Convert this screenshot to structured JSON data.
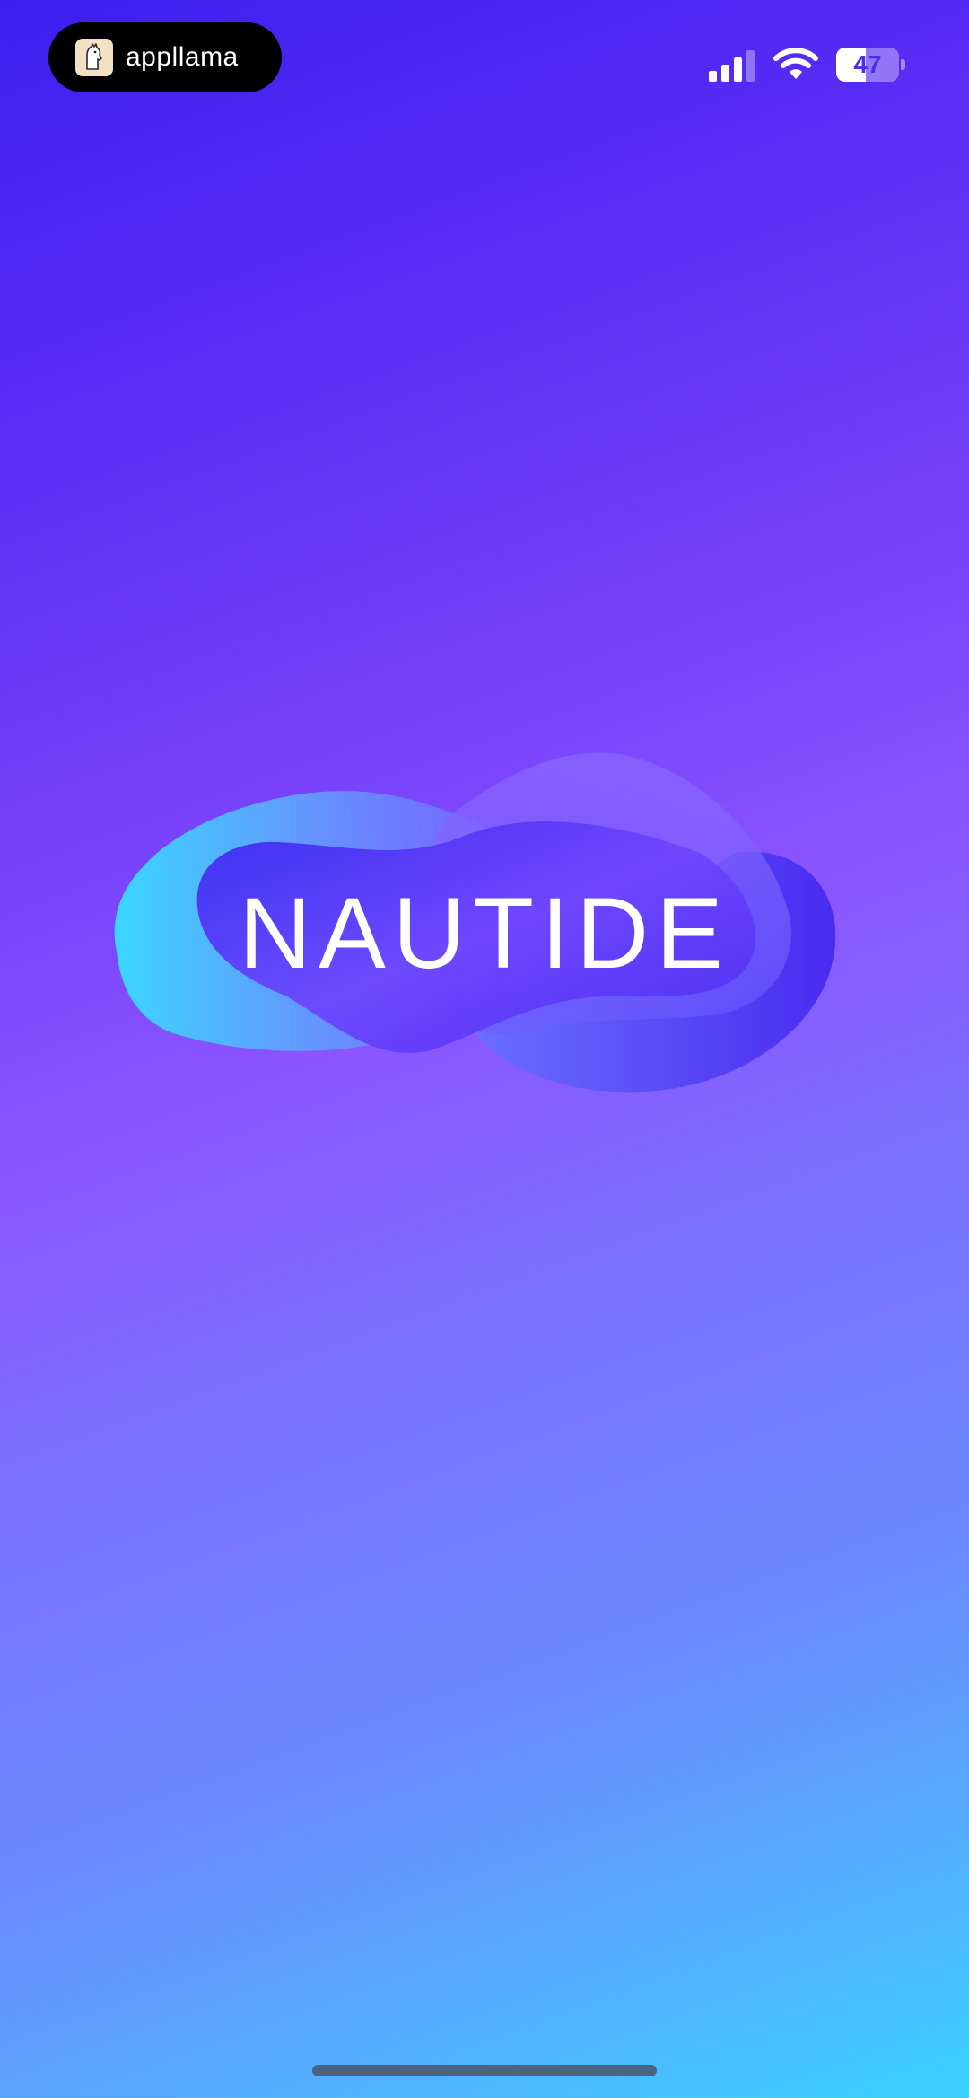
{
  "status_bar": {
    "app_badge": {
      "label": "appllama",
      "icon": "llama-icon"
    },
    "signal_icon": "cellular-signal-icon",
    "wifi_icon": "wifi-icon",
    "battery": {
      "level": 47,
      "label": "47",
      "icon": "battery-icon"
    }
  },
  "splash": {
    "brand_name": "NAUTIDE"
  },
  "colors": {
    "background_top": "#3d1ff0",
    "background_mid": "#8a55ff",
    "background_bottom": "#3ad2ff",
    "blob_cyan": "#3bd0ff",
    "blob_indigo": "#4a2bf0",
    "text": "#ffffff"
  }
}
